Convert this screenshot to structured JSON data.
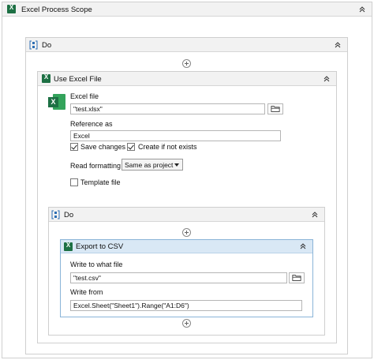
{
  "excel_process_scope": {
    "title": "Excel Process Scope"
  },
  "outer_do": {
    "title": "Do"
  },
  "use_excel_file": {
    "title": "Use Excel File",
    "excel_file_label": "Excel file",
    "excel_file_value": "\"test.xlsx\"",
    "reference_as_label": "Reference as",
    "reference_as_value": "Excel",
    "save_changes_label": "Save changes",
    "save_changes_checked": true,
    "create_if_not_exists_label": "Create if not exists",
    "create_if_not_exists_checked": true,
    "read_formatting_label": "Read formatting",
    "read_formatting_value": "Same as project",
    "template_file_label": "Template file",
    "template_file_checked": false
  },
  "inner_do": {
    "title": "Do"
  },
  "export_to_csv": {
    "title": "Export to CSV",
    "write_to_label": "Write to what file",
    "write_to_value": "\"test.csv\"",
    "write_from_label": "Write from",
    "write_from_value": "Excel.Sheet(\"Sheet1\").Range(\"A1:D6\")"
  },
  "colors": {
    "excel_green": "#1d7044",
    "sequence_blue": "#2d6fb4",
    "selected_border": "#8ab4d8",
    "selected_header": "#d9e8f5"
  },
  "icons": [
    "excel-icon",
    "sequence-icon",
    "collapse-icon",
    "add-activity-icon",
    "folder-icon"
  ]
}
